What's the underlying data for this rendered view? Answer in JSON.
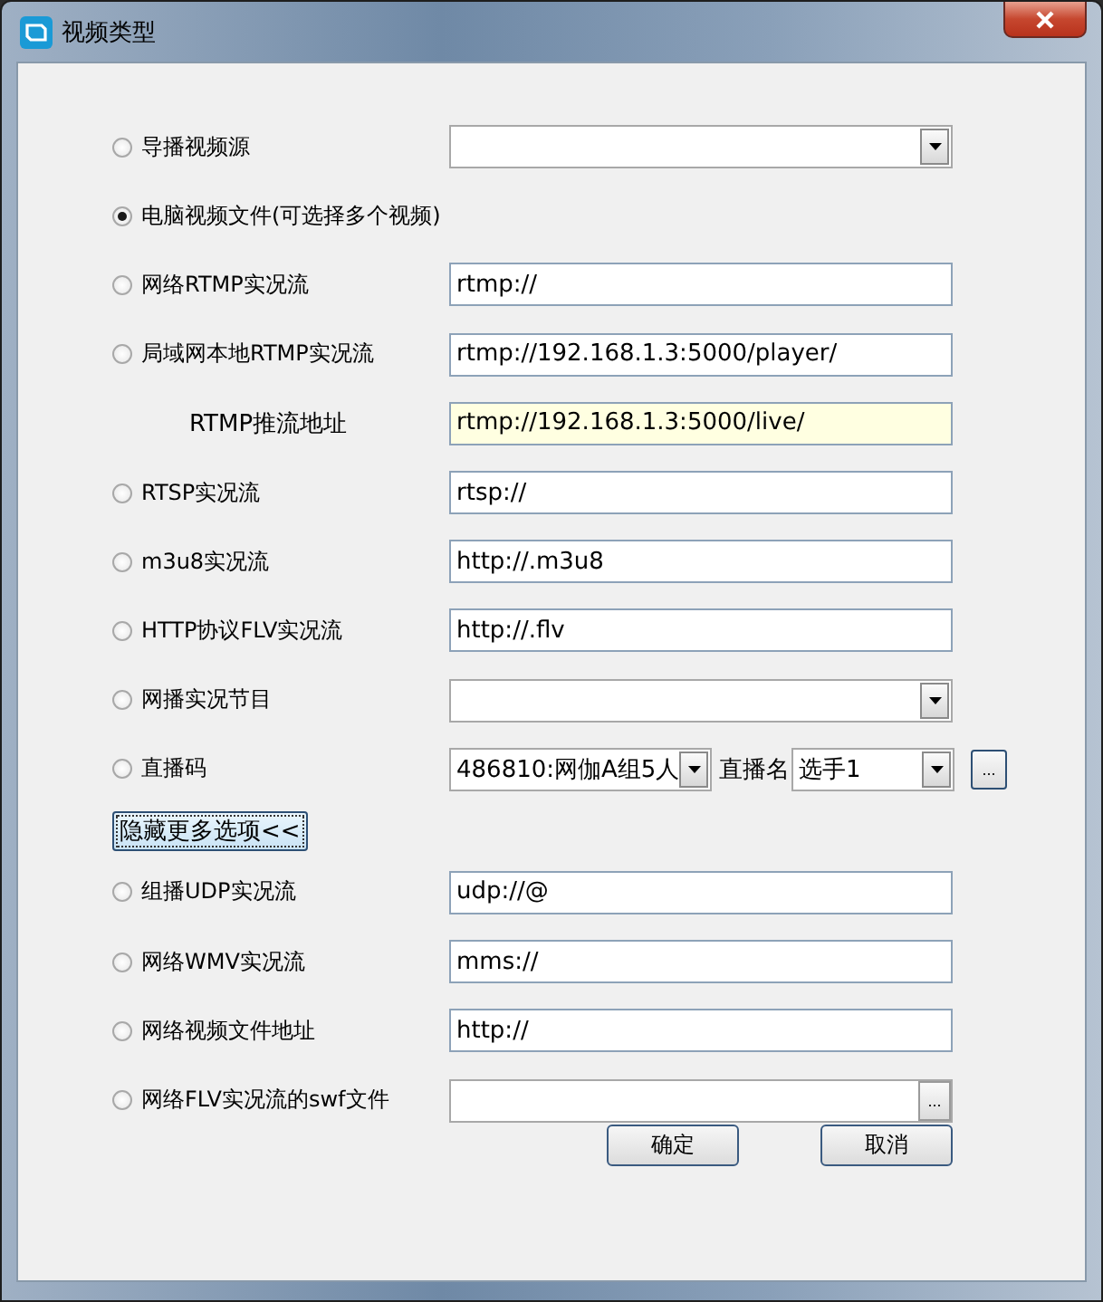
{
  "window": {
    "title": "视频类型"
  },
  "primary_sources": [
    {
      "kind": "combo",
      "label": "导播视频源",
      "selected": false
    }
  ],
  "sources": [
    {
      "kind": "none",
      "label": "电脑视频文件(可选择多个视频)",
      "selected": true
    },
    {
      "kind": "text",
      "label": "网络RTMP实况流",
      "selected": false,
      "value": "rtmp://"
    },
    {
      "kind": "text",
      "label": "局域网本地RTMP实况流",
      "selected": false,
      "value": "rtmp://192.168.1.3:5000/player/"
    },
    {
      "kind": "push",
      "label": "RTMP推流地址",
      "value": "rtmp://192.168.1.3:5000/live/"
    },
    {
      "kind": "text",
      "label": "RTSP实况流",
      "selected": false,
      "value": "rtsp://"
    },
    {
      "kind": "text",
      "label": "m3u8实况流",
      "selected": false,
      "value": "http://.m3u8"
    },
    {
      "kind": "text",
      "label": "HTTP协议FLV实况流",
      "selected": false,
      "value": "http://.flv"
    },
    {
      "kind": "combo",
      "label": "网播实况节目",
      "selected": false
    },
    {
      "kind": "live",
      "label": "直播码",
      "selected": false,
      "code": "486810:网伽A组5人",
      "name_label": "直播名",
      "name": "选手1",
      "button": "..."
    }
  ],
  "toggle_button": "隐藏更多选项<<",
  "more_sources": [
    {
      "kind": "text",
      "label": "组播UDP实况流",
      "selected": false,
      "value": "udp://@"
    },
    {
      "kind": "text",
      "label": "网络WMV实况流",
      "selected": false,
      "value": "mms://"
    },
    {
      "kind": "text",
      "label": "网络视频文件地址",
      "selected": false,
      "value": "http://"
    },
    {
      "kind": "file",
      "label": "网络FLV实况流的swf文件",
      "selected": false,
      "button": "..."
    }
  ],
  "buttons": [
    "确定",
    "取消"
  ]
}
